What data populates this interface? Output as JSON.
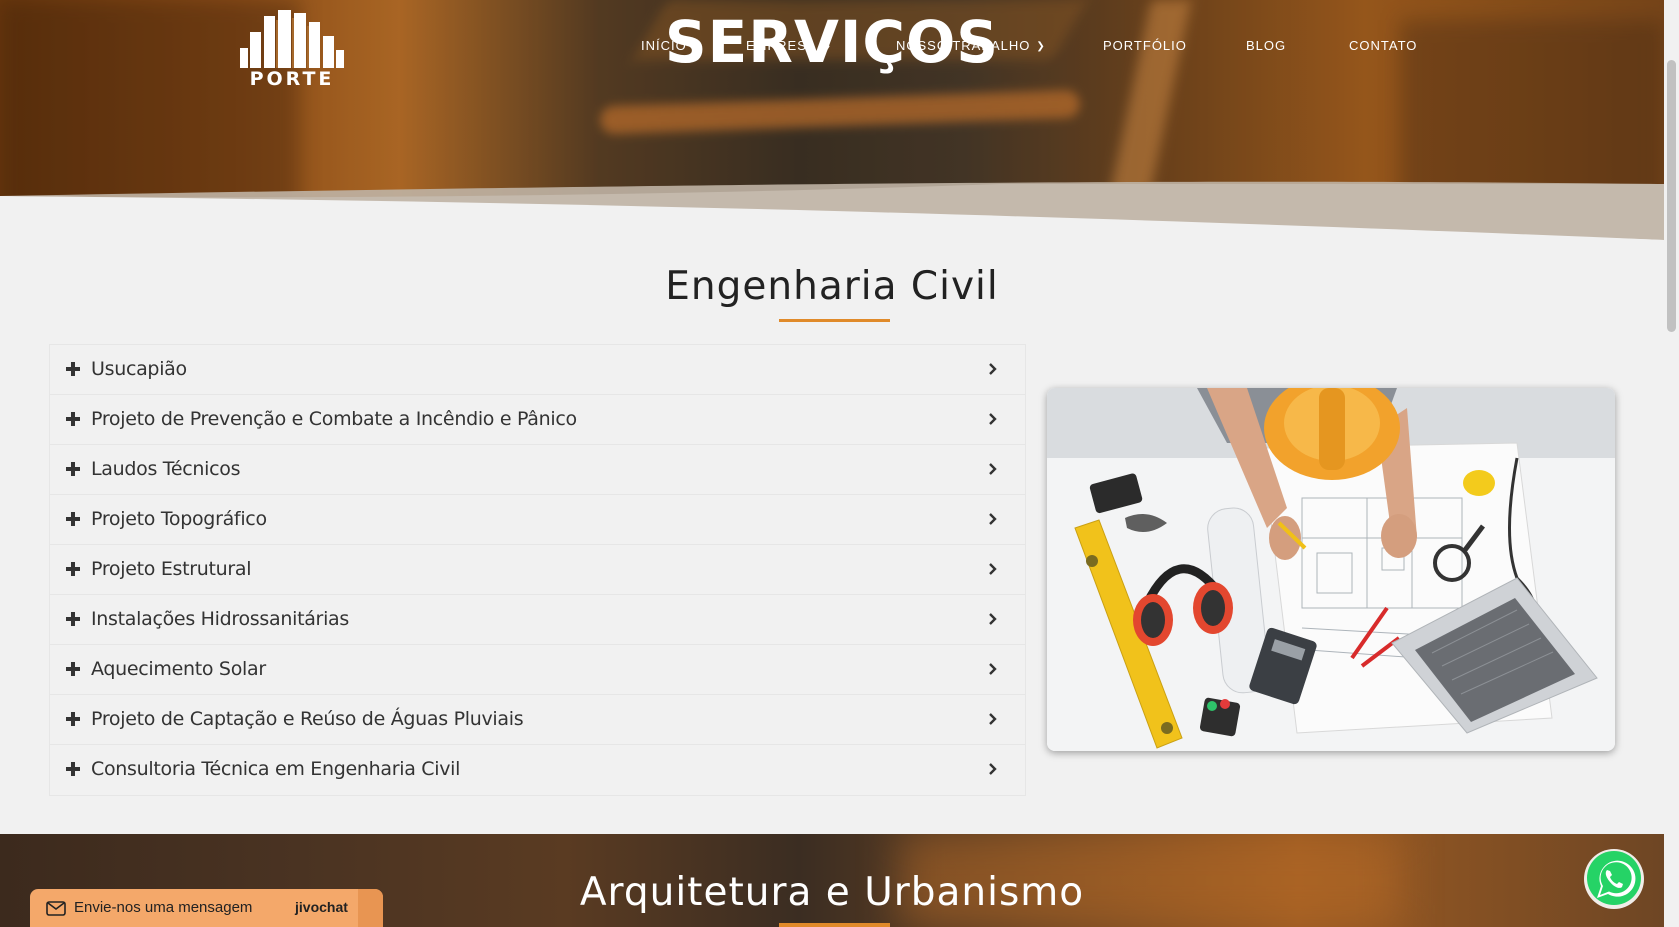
{
  "header": {
    "logo_text": "PORTE",
    "page_title": "SERVIÇOS",
    "nav": [
      {
        "label": "INÍCIO"
      },
      {
        "label": "EMPRESA"
      },
      {
        "label": "NOSSO TRABALHO"
      },
      {
        "label": "PORTFÓLIO"
      },
      {
        "label": "BLOG"
      },
      {
        "label": "CONTATO"
      }
    ]
  },
  "section": {
    "title": "Engenharia Civil",
    "accent_color": "#e08a2a",
    "services": [
      {
        "label": "Usucapião"
      },
      {
        "label": "Projeto de Prevenção e Combate a Incêndio e Pânico"
      },
      {
        "label": "Laudos Técnicos"
      },
      {
        "label": "Projeto Topográfico"
      },
      {
        "label": "Projeto Estrutural"
      },
      {
        "label": "Instalações Hidrossanitárias"
      },
      {
        "label": "Aquecimento Solar"
      },
      {
        "label": "Projeto de Captação e Reúso de Águas Pluviais"
      },
      {
        "label": "Consultoria Técnica em Engenharia Civil"
      }
    ]
  },
  "next_section": {
    "title": "Arquitetura e Urbanismo"
  },
  "chat_widget": {
    "label": "Envie-nos uma mensagem",
    "brand": "jivochat",
    "color": "#f4a86a"
  },
  "whatsapp": {
    "icon": "whatsapp-icon",
    "color": "#25d366"
  }
}
